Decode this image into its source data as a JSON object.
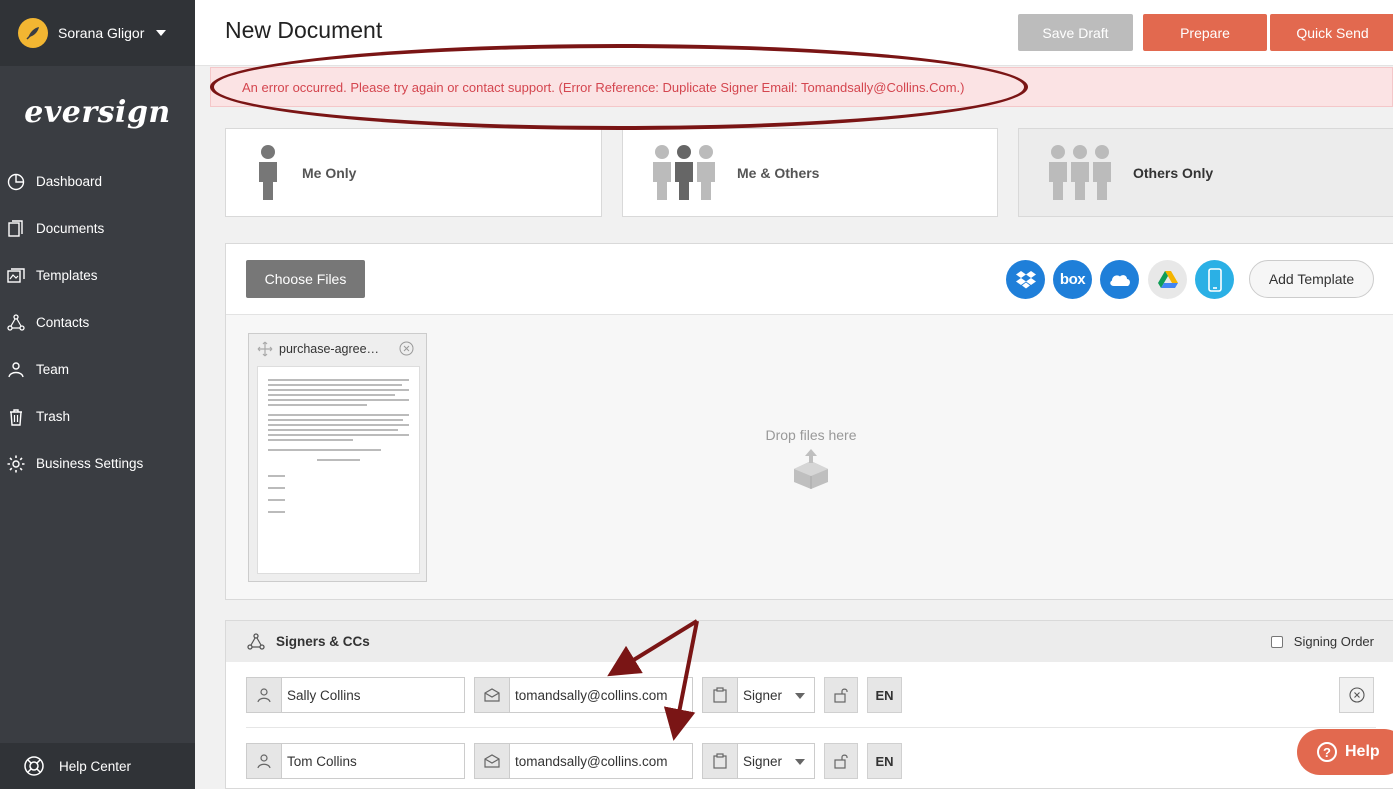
{
  "sidebar": {
    "user_name": "Sorana Gligor",
    "logo_text": "eversign",
    "items": [
      {
        "label": "Dashboard",
        "icon": "pie-chart-icon"
      },
      {
        "label": "Documents",
        "icon": "documents-icon"
      },
      {
        "label": "Templates",
        "icon": "templates-icon"
      },
      {
        "label": "Contacts",
        "icon": "contacts-icon"
      },
      {
        "label": "Team",
        "icon": "team-icon"
      },
      {
        "label": "Trash",
        "icon": "trash-icon"
      },
      {
        "label": "Business Settings",
        "icon": "gear-icon"
      }
    ],
    "help_center": "Help Center"
  },
  "header": {
    "title": "New Document",
    "save_draft": "Save Draft",
    "prepare": "Prepare",
    "quick_send": "Quick Send"
  },
  "error": {
    "message": "An error occurred. Please try again or contact support. (Error Reference: Duplicate Signer Email: Tomandsally@Collins.Com.)"
  },
  "signer_types": {
    "me_only": "Me Only",
    "me_others": "Me & Others",
    "others_only": "Others Only",
    "selected": "Others Only"
  },
  "upload": {
    "choose_files": "Choose Files",
    "add_template": "Add Template",
    "drop_files": "Drop files here",
    "file_name": "purchase-agree…",
    "cloud_services": [
      "dropbox-icon",
      "box-icon",
      "onedrive-icon",
      "google-drive-icon",
      "mobile-icon"
    ]
  },
  "signers": {
    "title": "Signers & CCs",
    "signing_order": "Signing Order",
    "rows": [
      {
        "name": "Sally Collins",
        "email": "tomandsally@collins.com",
        "role": "Signer",
        "lang": "EN"
      },
      {
        "name": "Tom Collins",
        "email": "tomandsally@collins.com",
        "role": "Signer",
        "lang": "EN"
      }
    ]
  },
  "help_button": "Help",
  "colors": {
    "accent": "#e2694f",
    "sidebar": "#3a3d42",
    "error_text": "#d4464f",
    "annotation": "#7a1515"
  }
}
